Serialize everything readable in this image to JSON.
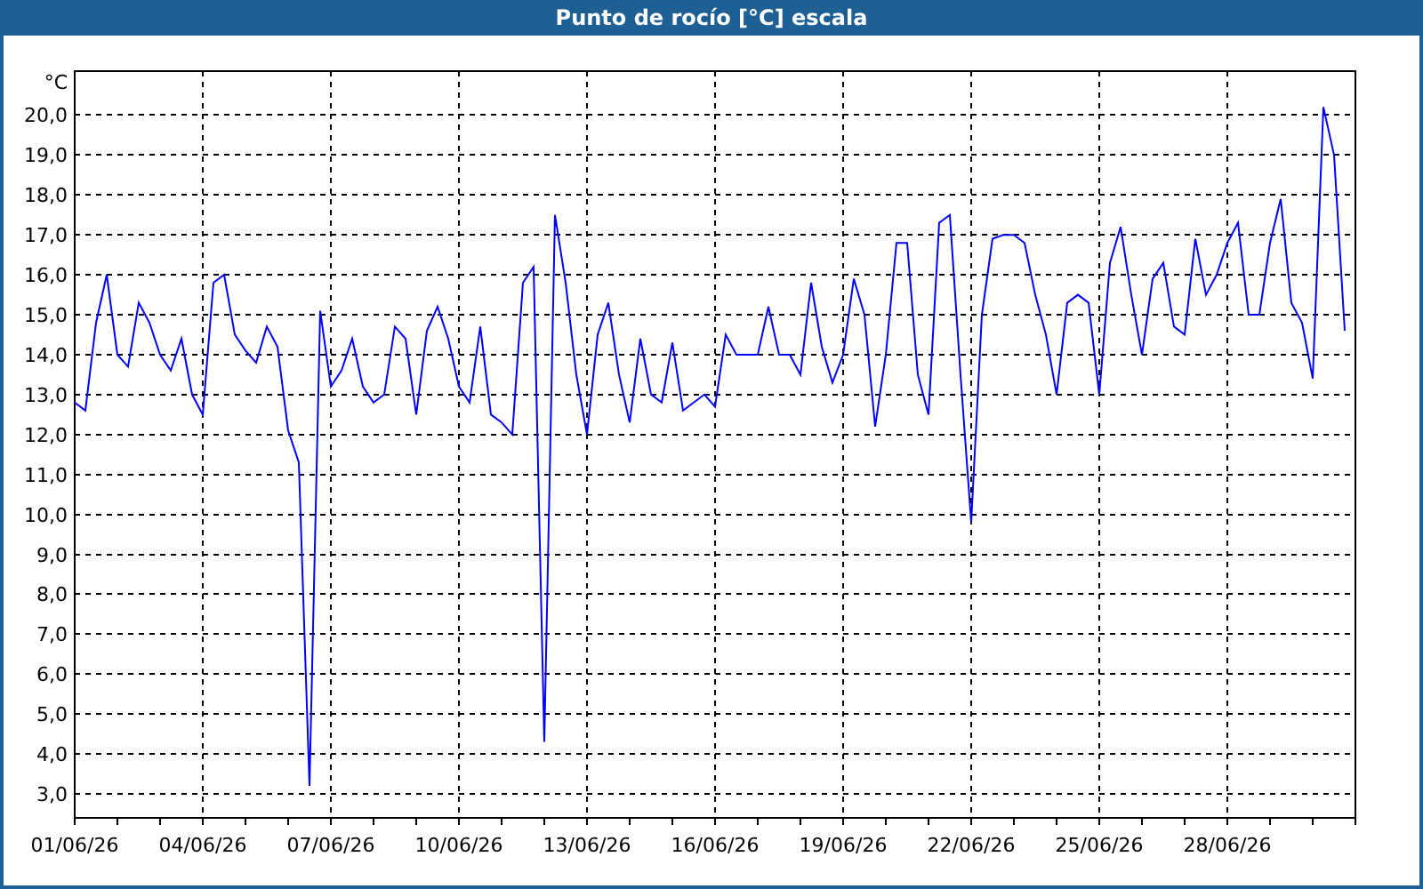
{
  "chart_data": {
    "type": "line",
    "title": "Punto de rocío [°C] escala",
    "ylabel": "°C",
    "grid": true,
    "ylim": [
      2.4,
      21.1
    ],
    "categories": [
      "01/06/26",
      null,
      null,
      null,
      null,
      null,
      null,
      null,
      null,
      null,
      null,
      null,
      "04/06/26",
      null,
      null,
      null,
      null,
      null,
      null,
      null,
      null,
      null,
      null,
      null,
      "07/06/26",
      null,
      null,
      null,
      null,
      null,
      null,
      null,
      null,
      null,
      null,
      null,
      "10/06/26",
      null,
      null,
      null,
      null,
      null,
      null,
      null,
      null,
      null,
      null,
      null,
      "13/06/26",
      null,
      null,
      null,
      null,
      null,
      null,
      null,
      null,
      null,
      null,
      null,
      "16/06/26",
      null,
      null,
      null,
      null,
      null,
      null,
      null,
      null,
      null,
      null,
      null,
      "19/06/26",
      null,
      null,
      null,
      null,
      null,
      null,
      null,
      null,
      null,
      null,
      null,
      "22/06/26",
      null,
      null,
      null,
      null,
      null,
      null,
      null,
      null,
      null,
      null,
      null,
      "25/06/26",
      null,
      null,
      null,
      null,
      null,
      null,
      null,
      null,
      null,
      null,
      null,
      "28/06/26",
      null,
      null,
      null,
      null,
      null,
      null,
      null,
      null,
      null,
      null,
      null
    ],
    "yticks": [
      {
        "value": 3,
        "label": "3,0"
      },
      {
        "value": 4,
        "label": "4,0"
      },
      {
        "value": 5,
        "label": "5,0"
      },
      {
        "value": 6,
        "label": "6,0"
      },
      {
        "value": 7,
        "label": "7,0"
      },
      {
        "value": 8,
        "label": "8,0"
      },
      {
        "value": 9,
        "label": "9,0"
      },
      {
        "value": 10,
        "label": "10,0"
      },
      {
        "value": 11,
        "label": "11,0"
      },
      {
        "value": 12,
        "label": "12,0"
      },
      {
        "value": 13,
        "label": "13,0"
      },
      {
        "value": 14,
        "label": "14,0"
      },
      {
        "value": 15,
        "label": "15,0"
      },
      {
        "value": 16,
        "label": "16,0"
      },
      {
        "value": 17,
        "label": "17,0"
      },
      {
        "value": 18,
        "label": "18,0"
      },
      {
        "value": 19,
        "label": "19,0"
      },
      {
        "value": 20,
        "label": "20,0"
      }
    ],
    "series": [
      {
        "color": "#0000ff",
        "values": [
          12.8,
          12.6,
          14.8,
          16.0,
          14.0,
          13.7,
          15.3,
          14.8,
          14.0,
          13.6,
          14.4,
          13.0,
          12.5,
          15.8,
          16.0,
          14.5,
          14.1,
          13.8,
          14.7,
          14.2,
          12.1,
          11.3,
          3.2,
          15.1,
          13.2,
          13.6,
          14.4,
          13.2,
          12.8,
          13.0,
          14.7,
          14.4,
          12.5,
          14.6,
          15.2,
          14.4,
          13.2,
          12.8,
          14.7,
          12.5,
          12.3,
          12.0,
          15.8,
          16.2,
          4.3,
          17.5,
          15.8,
          13.5,
          12.0,
          14.5,
          15.3,
          13.5,
          12.3,
          14.4,
          13.0,
          12.8,
          14.3,
          12.6,
          12.8,
          13.0,
          12.7,
          14.5,
          14.0,
          14.0,
          14.0,
          15.2,
          14.0,
          14.0,
          13.5,
          15.8,
          14.2,
          13.3,
          14.0,
          15.9,
          15.0,
          12.2,
          14.0,
          16.8,
          16.8,
          13.5,
          12.5,
          17.3,
          17.5,
          13.5,
          9.8,
          15.0,
          16.9,
          17.0,
          17.0,
          16.8,
          15.5,
          14.5,
          13.0,
          15.3,
          15.5,
          15.3,
          13.0,
          16.3,
          17.2,
          15.5,
          14.0,
          15.9,
          16.3,
          14.7,
          14.5,
          16.9,
          15.5,
          16.0,
          16.8,
          17.3,
          15.0,
          15.0,
          16.8,
          17.9,
          15.3,
          14.8,
          13.4,
          20.2,
          19.0,
          14.6
        ]
      }
    ]
  }
}
